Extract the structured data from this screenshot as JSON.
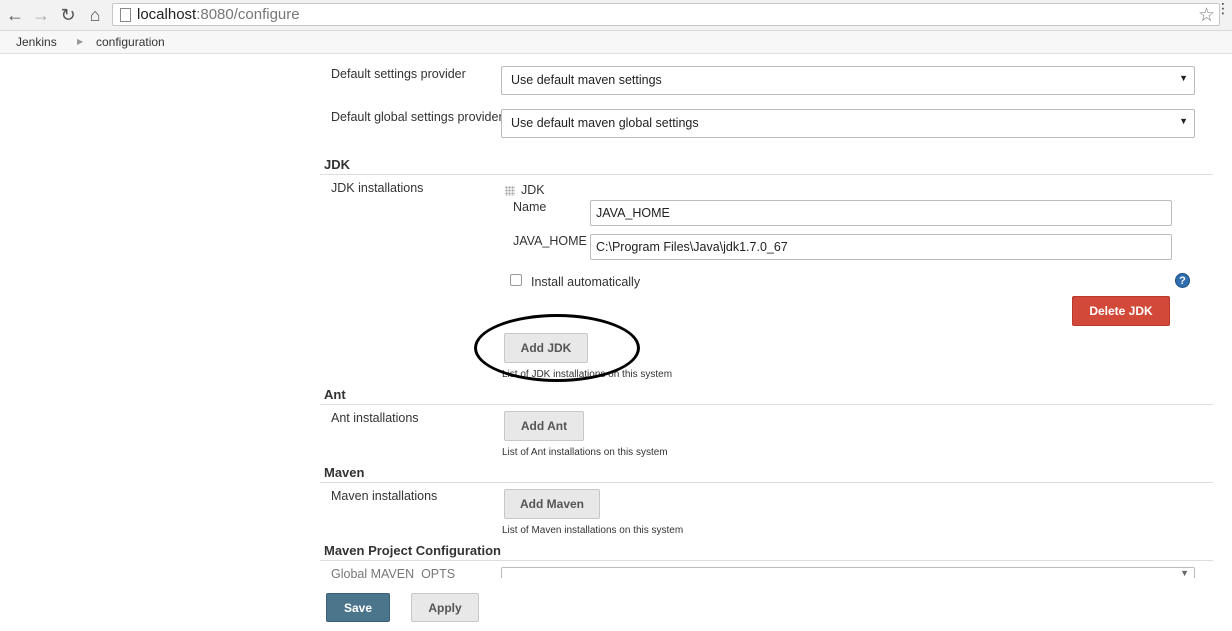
{
  "browser": {
    "url_host": "localhost",
    "url_rest": ":8080/configure",
    "back_icon": "back-arrow-icon",
    "forward_icon": "forward-arrow-icon",
    "reload_icon": "reload-icon",
    "home_icon": "home-icon"
  },
  "breadcrumb": {
    "items": [
      "Jenkins",
      "configuration"
    ]
  },
  "maven_settings": {
    "default_settings_label": "Default settings provider",
    "default_settings_value": "Use default maven settings",
    "default_global_label": "Default global settings provider",
    "default_global_value": "Use default maven global settings"
  },
  "jdk": {
    "section_title": "JDK",
    "installations_label": "JDK installations",
    "entry_title": "JDK",
    "name_label": "Name",
    "name_value": "JAVA_HOME",
    "java_home_label": "JAVA_HOME",
    "java_home_value": "C:\\Program Files\\Java\\jdk1.7.0_67",
    "install_auto_label": "Install automatically",
    "delete_button": "Delete JDK",
    "add_button": "Add JDK",
    "help_text": "List of JDK installations on this system"
  },
  "ant": {
    "section_title": "Ant",
    "installations_label": "Ant installations",
    "add_button": "Add Ant",
    "help_text": "List of Ant installations on this system"
  },
  "maven": {
    "section_title": "Maven",
    "installations_label": "Maven installations",
    "add_button": "Add Maven",
    "help_text": "List of Maven installations on this system"
  },
  "maven_project": {
    "section_title": "Maven Project Configuration",
    "global_opts_label": "Global MAVEN_OPTS"
  },
  "actions": {
    "save": "Save",
    "apply": "Apply"
  },
  "colors": {
    "delete_red": "#d24939",
    "save_blue": "#4b758b",
    "help_blue": "#2f6fb0"
  }
}
